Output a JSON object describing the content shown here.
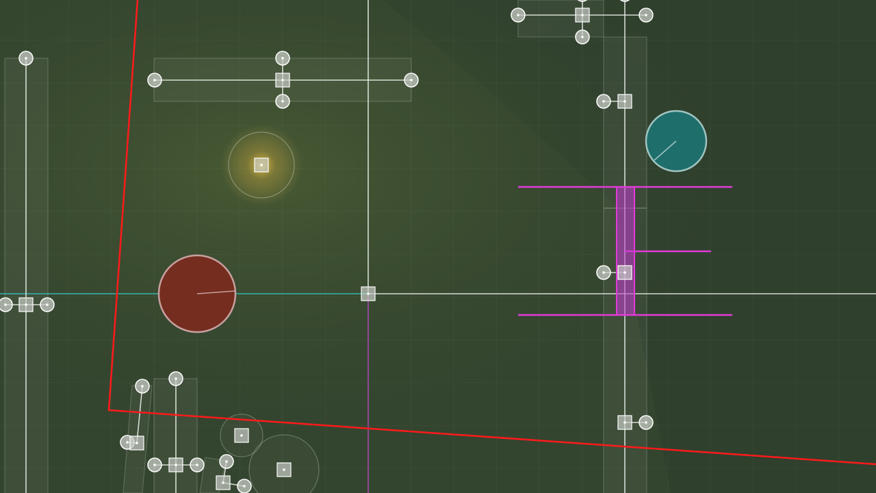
{
  "scene": {
    "kind": "2D physics level editor viewport",
    "colors": {
      "background": "#34452f",
      "background_light_patch": "#4a5a34",
      "grid_line": "#ffffff",
      "gizmo": "#e8ece6",
      "selection_outline": "#ff1a1a",
      "magenta_guides": "#e23bd9",
      "x_axis_guide": "#37c9c9",
      "y_axis_guide": "#c94bd6",
      "light_glow": "#f0c84a",
      "red_ball": "#7b2e1f",
      "teal_ball": "#1f7070"
    },
    "icons": [
      "square-handle-icon",
      "circle-handle-icon",
      "ball-red-icon",
      "ball-teal-icon",
      "light-source-icon"
    ]
  }
}
